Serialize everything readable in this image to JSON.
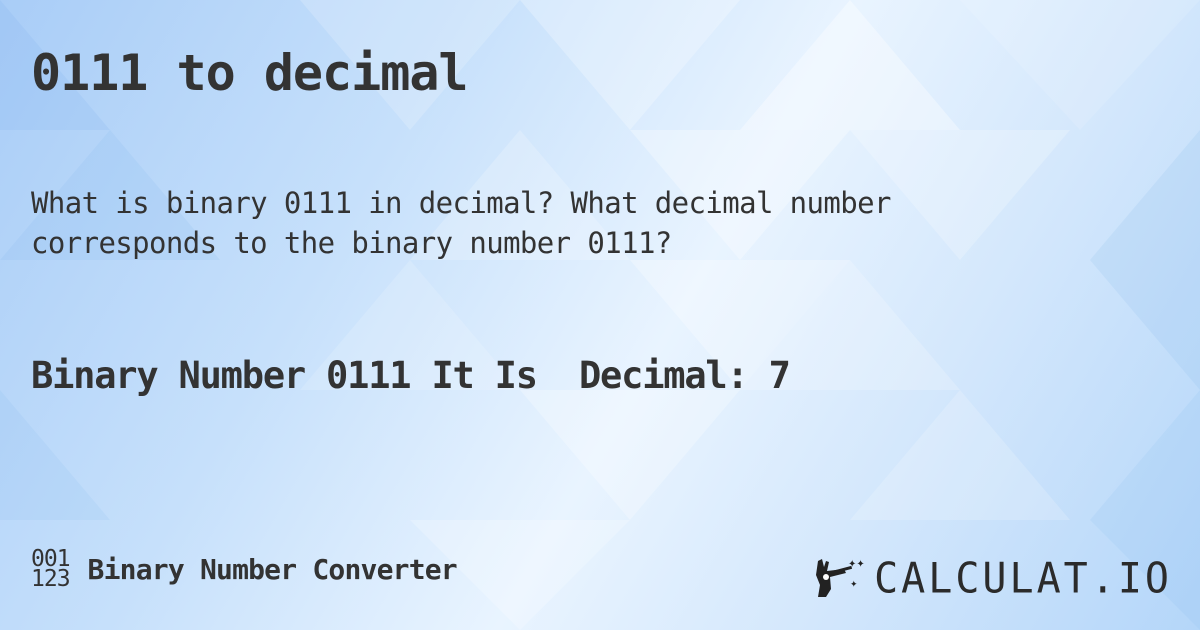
{
  "title": "0111 to decimal",
  "question": "What is binary 0111 in decimal? What decimal number corresponds to the binary number 0111?",
  "answer": "Binary Number 0111 It Is  Decimal: 7",
  "footer": {
    "icon_top": "001",
    "icon_bottom": "123",
    "label": "Binary Number Converter"
  },
  "brand": {
    "name": "CALCULAT.IO",
    "icon": "magic-wand-hand-icon"
  },
  "colors": {
    "text": "#333333",
    "background_light": "#e9f4ff",
    "background_dark": "#a9cdf7"
  }
}
